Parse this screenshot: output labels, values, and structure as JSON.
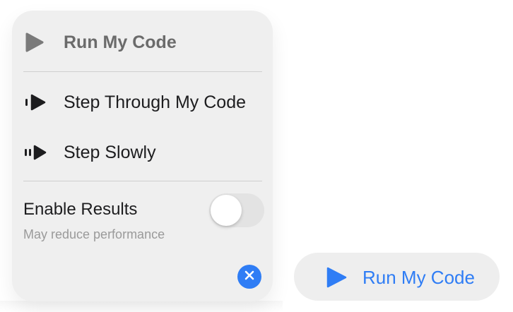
{
  "popover": {
    "run_label": "Run My Code",
    "step_label": "Step Through My Code",
    "slow_label": "Step Slowly",
    "results_label": "Enable Results",
    "results_sub": "May reduce performance",
    "results_enabled": false
  },
  "run_button": {
    "label": "Run My Code"
  },
  "icons": {
    "run": "play-icon",
    "step": "step-through-icon",
    "slow": "step-slowly-icon",
    "close": "close-icon",
    "run_button": "play-icon"
  },
  "colors": {
    "accent": "#2f7df5",
    "panel": "#efefef",
    "muted_text": "#6b6b6b"
  }
}
